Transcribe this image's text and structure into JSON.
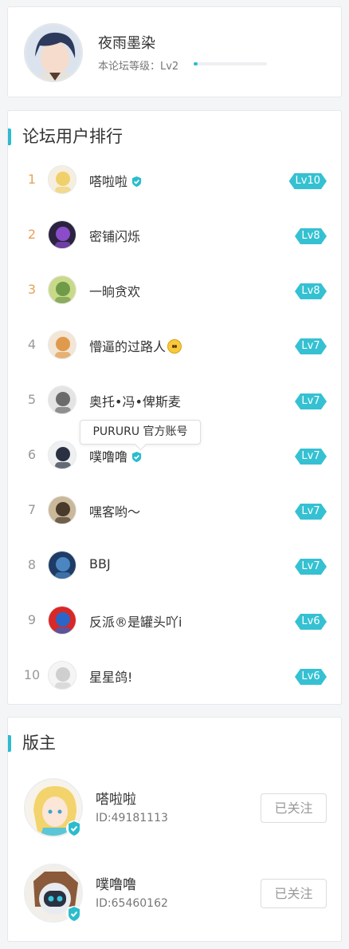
{
  "profile": {
    "username": "夜雨墨染",
    "level_label": "本论坛等级：Lv2",
    "level_progress_pct": 5
  },
  "ranking": {
    "title": "论坛用户排行",
    "items": [
      {
        "rank": "1",
        "name": "嗒啦啦",
        "level": "Lv10",
        "verified": true
      },
      {
        "rank": "2",
        "name": "密铺闪烁",
        "level": "Lv8"
      },
      {
        "rank": "3",
        "name": "一晌贪欢",
        "level": "Lv8"
      },
      {
        "rank": "4",
        "name": "懵逼的过路人",
        "level": "Lv7",
        "emoji": true
      },
      {
        "rank": "5",
        "name": "奥托•冯•俾斯麦",
        "level": "Lv7"
      },
      {
        "rank": "6",
        "name": "噗噜噜",
        "level": "Lv7",
        "verified": true
      },
      {
        "rank": "7",
        "name": "嘿客哟～",
        "level": "Lv7"
      },
      {
        "rank": "8",
        "name": "BBJ",
        "level": "Lv7"
      },
      {
        "rank": "9",
        "name": "反派®是罐头吖i",
        "level": "Lv6"
      },
      {
        "rank": "10",
        "name": "星星鸽!",
        "level": "Lv6"
      }
    ],
    "tooltip": "PURURU 官方账号"
  },
  "moderators": {
    "title": "版主",
    "items": [
      {
        "name": "嗒啦啦",
        "id": "ID:49181113",
        "follow_label": "已关注"
      },
      {
        "name": "噗噜噜",
        "id": "ID:65460162",
        "follow_label": "已关注"
      }
    ]
  },
  "colors": {
    "accent": "#2bbccd",
    "rank_top": "#e8a15b",
    "level_badge": "#35c1d2"
  }
}
